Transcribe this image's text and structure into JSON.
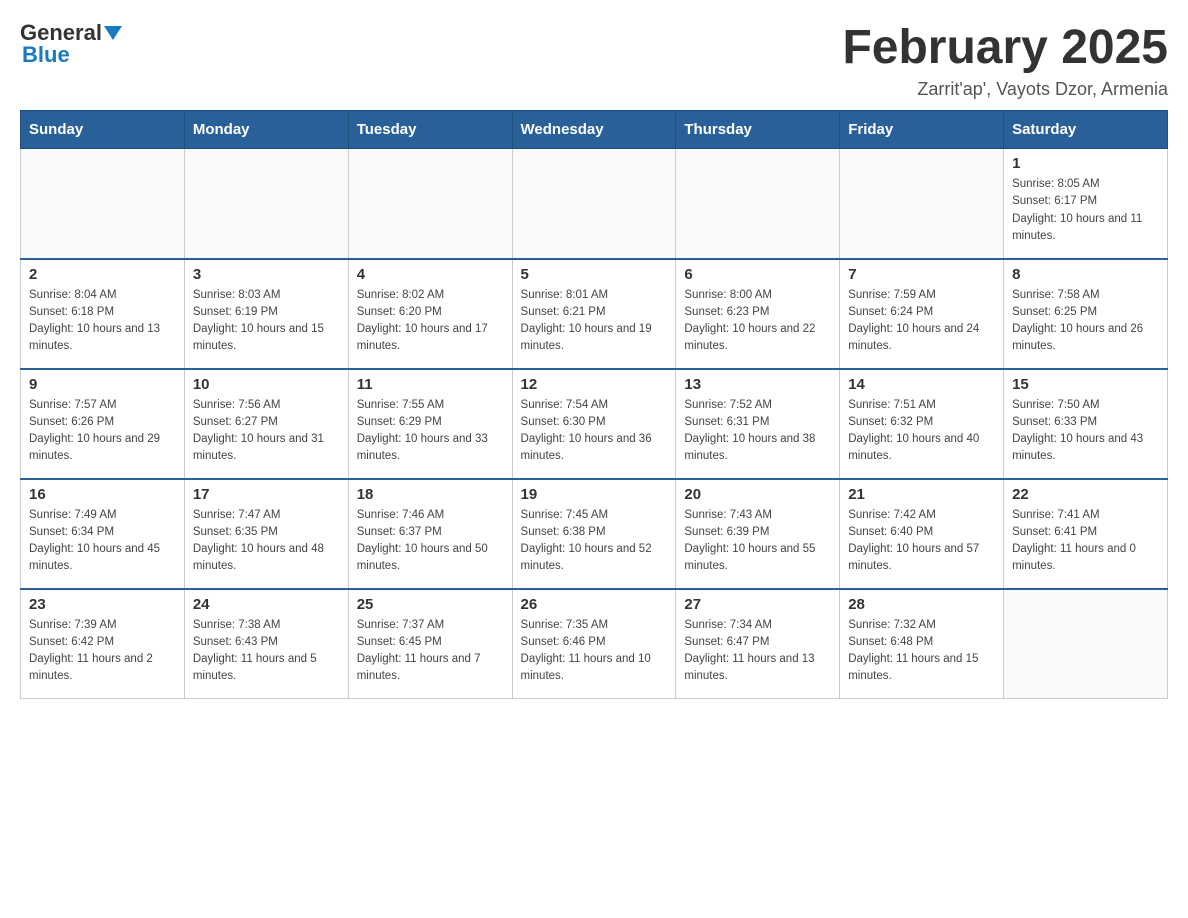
{
  "header": {
    "logo_general": "General",
    "logo_blue": "Blue",
    "month_title": "February 2025",
    "location": "Zarrit'ap', Vayots Dzor, Armenia"
  },
  "weekdays": [
    "Sunday",
    "Monday",
    "Tuesday",
    "Wednesday",
    "Thursday",
    "Friday",
    "Saturday"
  ],
  "weeks": [
    [
      {
        "day": "",
        "info": ""
      },
      {
        "day": "",
        "info": ""
      },
      {
        "day": "",
        "info": ""
      },
      {
        "day": "",
        "info": ""
      },
      {
        "day": "",
        "info": ""
      },
      {
        "day": "",
        "info": ""
      },
      {
        "day": "1",
        "info": "Sunrise: 8:05 AM\nSunset: 6:17 PM\nDaylight: 10 hours and 11 minutes."
      }
    ],
    [
      {
        "day": "2",
        "info": "Sunrise: 8:04 AM\nSunset: 6:18 PM\nDaylight: 10 hours and 13 minutes."
      },
      {
        "day": "3",
        "info": "Sunrise: 8:03 AM\nSunset: 6:19 PM\nDaylight: 10 hours and 15 minutes."
      },
      {
        "day": "4",
        "info": "Sunrise: 8:02 AM\nSunset: 6:20 PM\nDaylight: 10 hours and 17 minutes."
      },
      {
        "day": "5",
        "info": "Sunrise: 8:01 AM\nSunset: 6:21 PM\nDaylight: 10 hours and 19 minutes."
      },
      {
        "day": "6",
        "info": "Sunrise: 8:00 AM\nSunset: 6:23 PM\nDaylight: 10 hours and 22 minutes."
      },
      {
        "day": "7",
        "info": "Sunrise: 7:59 AM\nSunset: 6:24 PM\nDaylight: 10 hours and 24 minutes."
      },
      {
        "day": "8",
        "info": "Sunrise: 7:58 AM\nSunset: 6:25 PM\nDaylight: 10 hours and 26 minutes."
      }
    ],
    [
      {
        "day": "9",
        "info": "Sunrise: 7:57 AM\nSunset: 6:26 PM\nDaylight: 10 hours and 29 minutes."
      },
      {
        "day": "10",
        "info": "Sunrise: 7:56 AM\nSunset: 6:27 PM\nDaylight: 10 hours and 31 minutes."
      },
      {
        "day": "11",
        "info": "Sunrise: 7:55 AM\nSunset: 6:29 PM\nDaylight: 10 hours and 33 minutes."
      },
      {
        "day": "12",
        "info": "Sunrise: 7:54 AM\nSunset: 6:30 PM\nDaylight: 10 hours and 36 minutes."
      },
      {
        "day": "13",
        "info": "Sunrise: 7:52 AM\nSunset: 6:31 PM\nDaylight: 10 hours and 38 minutes."
      },
      {
        "day": "14",
        "info": "Sunrise: 7:51 AM\nSunset: 6:32 PM\nDaylight: 10 hours and 40 minutes."
      },
      {
        "day": "15",
        "info": "Sunrise: 7:50 AM\nSunset: 6:33 PM\nDaylight: 10 hours and 43 minutes."
      }
    ],
    [
      {
        "day": "16",
        "info": "Sunrise: 7:49 AM\nSunset: 6:34 PM\nDaylight: 10 hours and 45 minutes."
      },
      {
        "day": "17",
        "info": "Sunrise: 7:47 AM\nSunset: 6:35 PM\nDaylight: 10 hours and 48 minutes."
      },
      {
        "day": "18",
        "info": "Sunrise: 7:46 AM\nSunset: 6:37 PM\nDaylight: 10 hours and 50 minutes."
      },
      {
        "day": "19",
        "info": "Sunrise: 7:45 AM\nSunset: 6:38 PM\nDaylight: 10 hours and 52 minutes."
      },
      {
        "day": "20",
        "info": "Sunrise: 7:43 AM\nSunset: 6:39 PM\nDaylight: 10 hours and 55 minutes."
      },
      {
        "day": "21",
        "info": "Sunrise: 7:42 AM\nSunset: 6:40 PM\nDaylight: 10 hours and 57 minutes."
      },
      {
        "day": "22",
        "info": "Sunrise: 7:41 AM\nSunset: 6:41 PM\nDaylight: 11 hours and 0 minutes."
      }
    ],
    [
      {
        "day": "23",
        "info": "Sunrise: 7:39 AM\nSunset: 6:42 PM\nDaylight: 11 hours and 2 minutes."
      },
      {
        "day": "24",
        "info": "Sunrise: 7:38 AM\nSunset: 6:43 PM\nDaylight: 11 hours and 5 minutes."
      },
      {
        "day": "25",
        "info": "Sunrise: 7:37 AM\nSunset: 6:45 PM\nDaylight: 11 hours and 7 minutes."
      },
      {
        "day": "26",
        "info": "Sunrise: 7:35 AM\nSunset: 6:46 PM\nDaylight: 11 hours and 10 minutes."
      },
      {
        "day": "27",
        "info": "Sunrise: 7:34 AM\nSunset: 6:47 PM\nDaylight: 11 hours and 13 minutes."
      },
      {
        "day": "28",
        "info": "Sunrise: 7:32 AM\nSunset: 6:48 PM\nDaylight: 11 hours and 15 minutes."
      },
      {
        "day": "",
        "info": ""
      }
    ]
  ]
}
